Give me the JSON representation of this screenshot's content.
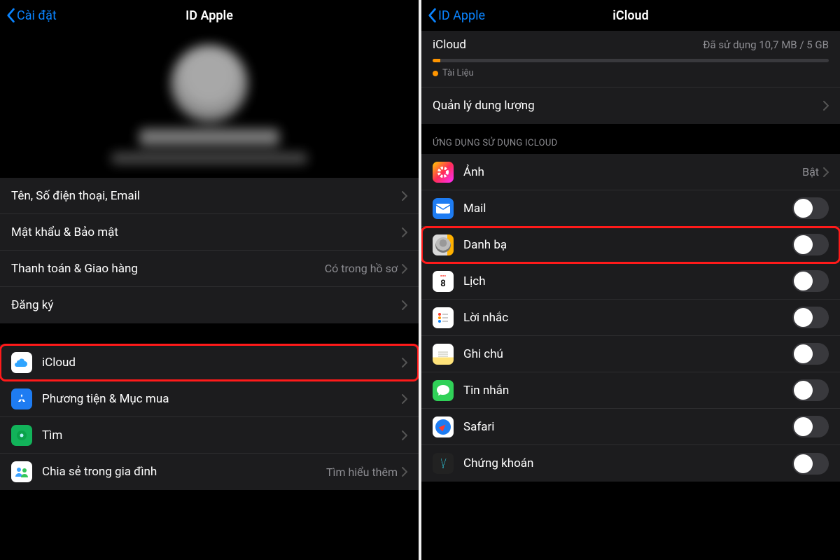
{
  "left": {
    "back": "Cài đặt",
    "title": "ID Apple",
    "group1": [
      {
        "label": "Tên, Số điện thoại, Email",
        "value": ""
      },
      {
        "label": "Mật khẩu & Bảo mật",
        "value": ""
      },
      {
        "label": "Thanh toán & Giao hàng",
        "value": "Có trong hồ sơ"
      },
      {
        "label": "Đăng ký",
        "value": ""
      }
    ],
    "group2": [
      {
        "label": "iCloud",
        "value": "",
        "highlight": true
      },
      {
        "label": "Phương tiện & Mục mua",
        "value": ""
      },
      {
        "label": "Tìm",
        "value": ""
      },
      {
        "label": "Chia sẻ trong gia đình",
        "value": "Tìm hiểu thêm"
      }
    ]
  },
  "right": {
    "back": "ID Apple",
    "title": "iCloud",
    "storage": {
      "heading": "iCloud",
      "usage": "Đã sử dụng 10,7 MB / 5 GB",
      "legend": "Tài Liệu",
      "manage": "Quản lý dung lượng"
    },
    "section": "ỨNG DỤNG SỬ DỤNG ICLOUD",
    "apps": [
      {
        "label": "Ảnh",
        "type": "link",
        "value": "Bật"
      },
      {
        "label": "Mail",
        "type": "toggle",
        "on": false
      },
      {
        "label": "Danh bạ",
        "type": "toggle",
        "on": false,
        "highlight": true
      },
      {
        "label": "Lịch",
        "type": "toggle",
        "on": false
      },
      {
        "label": "Lời nhắc",
        "type": "toggle",
        "on": false
      },
      {
        "label": "Ghi chú",
        "type": "toggle",
        "on": false
      },
      {
        "label": "Tin nhắn",
        "type": "toggle",
        "on": false
      },
      {
        "label": "Safari",
        "type": "toggle",
        "on": false
      },
      {
        "label": "Chứng khoán",
        "type": "toggle",
        "on": false
      }
    ]
  }
}
